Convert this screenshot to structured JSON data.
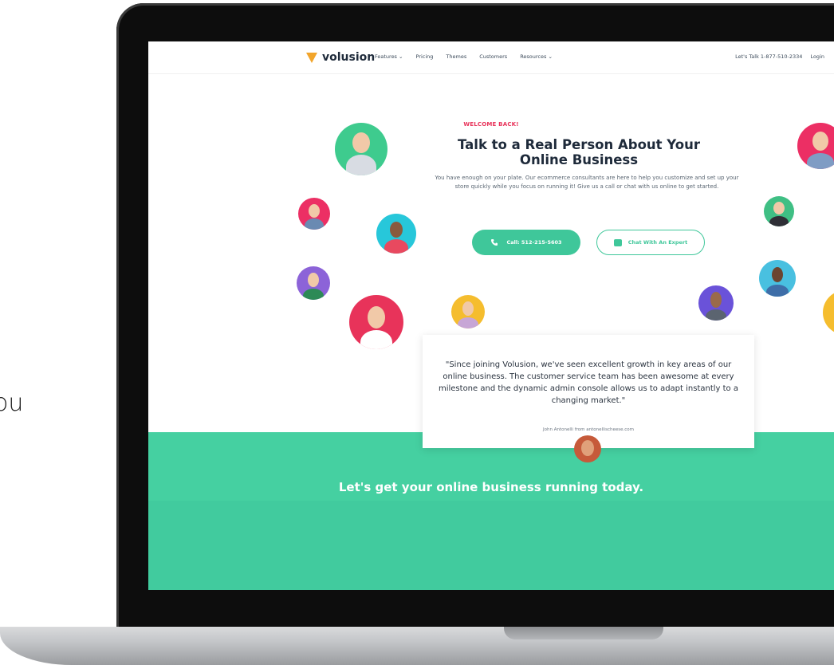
{
  "side_text": "ou",
  "nav": {
    "logo_text": "volusion",
    "links": [
      "Features",
      "Pricing",
      "Themes",
      "Customers",
      "Resources"
    ],
    "right": {
      "talk": "Let's Talk 1-877-510-2334",
      "login": "Login"
    }
  },
  "hero": {
    "eyebrow": "WELCOME BACK!",
    "headline": "Talk to a Real Person About Your Online Business",
    "subtext": "You have enough on your plate. Our ecommerce consultants are here to help you customize and set up your store quickly while you focus on running it! Give us a call or chat with us online to get started.",
    "call_button": "Call: 512-215-5603",
    "chat_button": "Chat With An Expert"
  },
  "testimonial": {
    "quote": "\"Since joining Volusion, we've seen excellent growth in key areas of our online business. The customer service team has been awesome at every milestone and the dynamic admin console allows us to adapt instantly to a changing market.\"",
    "attribution": "John Antonelli from antonellischeese.com"
  },
  "cta": "Let's get your online business running today.",
  "colors": {
    "accent_green": "#45d0a1",
    "eyebrow_pink": "#e8335a",
    "dark_text": "#1e2a3a"
  },
  "icons": [
    "phone-icon",
    "chat-icon",
    "chevron-down-icon",
    "volusion-logo-icon"
  ]
}
